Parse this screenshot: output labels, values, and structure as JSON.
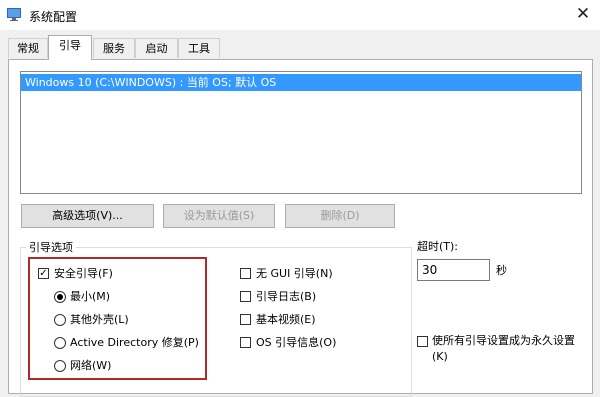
{
  "window": {
    "title": "系统配置",
    "close_icon": "close-icon"
  },
  "tabs": [
    {
      "label": "常规",
      "active": false
    },
    {
      "label": "引导",
      "active": true
    },
    {
      "label": "服务",
      "active": false
    },
    {
      "label": "启动",
      "active": false
    },
    {
      "label": "工具",
      "active": false
    }
  ],
  "os_list": {
    "entries": [
      "Windows 10 (C:\\WINDOWS) : 当前 OS; 默认 OS"
    ],
    "selected_index": 0
  },
  "buttons": {
    "advanced": "高级选项(V)...",
    "set_default": "设为默认值(S)",
    "delete": "删除(D)"
  },
  "boot_options": {
    "label": "引导选项",
    "safe_boot": {
      "label": "安全引导(F)",
      "checked": true
    },
    "safe_modes": [
      {
        "label": "最小(M)",
        "selected": true
      },
      {
        "label": "其他外壳(L)",
        "selected": false
      },
      {
        "label": "Active Directory 修复(P)",
        "selected": false
      },
      {
        "label": "网络(W)",
        "selected": false
      }
    ],
    "right_options": [
      {
        "label": "无 GUI 引导(N)",
        "checked": false
      },
      {
        "label": "引导日志(B)",
        "checked": false
      },
      {
        "label": "基本视频(E)",
        "checked": false
      },
      {
        "label": "OS 引导信息(O)",
        "checked": false
      }
    ]
  },
  "timeout": {
    "label": "超时(T):",
    "value": "30",
    "unit": "秒"
  },
  "permanent": {
    "label_line1": "使所有引导设置成为永久设置",
    "label_line2": "(K)",
    "checked": false
  },
  "colors": {
    "selection": "#3399ff",
    "highlight_box": "#b02a2a",
    "panel": "#ffffff",
    "background": "#f0f0f0"
  }
}
